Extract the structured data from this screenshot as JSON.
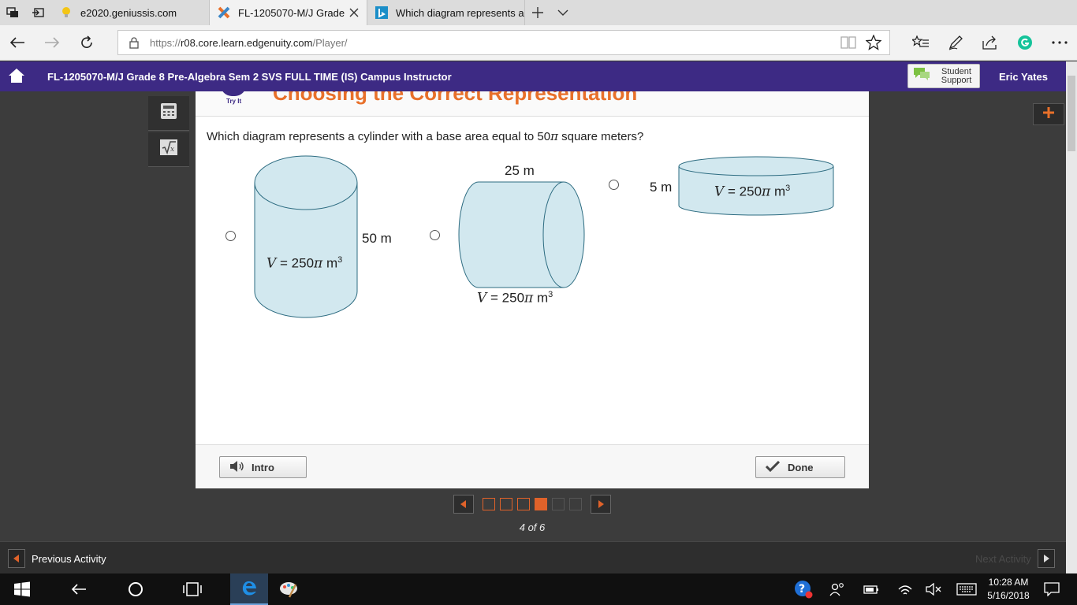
{
  "browser": {
    "tabs": [
      {
        "label": "e2020.geniussis.com",
        "favicon": "lightbulb-icon"
      },
      {
        "label": "FL-1205070-M/J Grade",
        "favicon": "edgenuity-x-icon",
        "active": true
      },
      {
        "label": "Which diagram represents a",
        "favicon": "bing-icon"
      }
    ],
    "url_prefix": "https://",
    "url_host": "r08.core.learn.edgenuity.com",
    "url_path": "/Player/"
  },
  "app": {
    "course_title": "FL-1205070-M/J Grade 8 Pre-Algebra Sem 2 SVS FULL TIME (IS) Campus Instructor",
    "support_label": "Student Support",
    "user_name": "Eric Yates",
    "brand_color": "#3d2a84",
    "accent_color": "#e8702a"
  },
  "lesson": {
    "badge": "Try It",
    "section_title": "Choosing the Correct Representation",
    "question_pre": "Which diagram represents a cylinder with a base area equal to 50",
    "question_pi": "π",
    "question_post": " square meters?",
    "options": [
      {
        "height_label": "50 m",
        "vol_var": "V",
        "vol_text": " = 250",
        "vol_pi": "π",
        "vol_unit": " m",
        "vol_exp": "3"
      },
      {
        "top_label": "25 m",
        "vol_var": "V",
        "vol_text": " = 250",
        "vol_pi": "π",
        "vol_unit": " m",
        "vol_exp": "3"
      },
      {
        "height_label": "5 m",
        "vol_var": "V",
        "vol_text": " = 250",
        "vol_pi": "π",
        "vol_unit": " m",
        "vol_exp": "3"
      }
    ],
    "intro_label": "Intro",
    "done_label": "Done"
  },
  "pager": {
    "current": 4,
    "total": 6,
    "label": "4 of 6"
  },
  "activity": {
    "prev_label": "Previous Activity",
    "next_label": "Next Activity"
  },
  "taskbar": {
    "time": "10:28 AM",
    "date": "5/16/2018"
  }
}
